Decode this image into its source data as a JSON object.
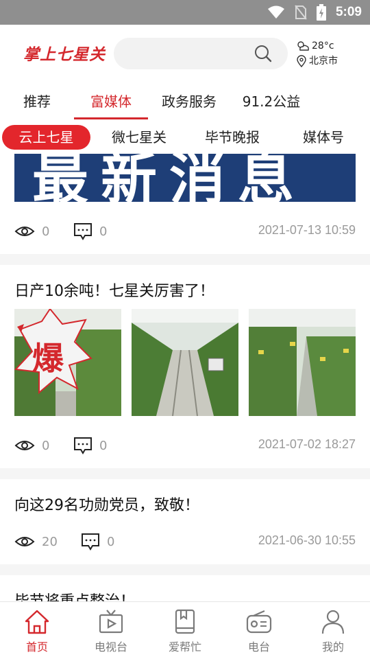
{
  "status_bar": {
    "time": "5:09",
    "icons": [
      "wifi-icon",
      "no-sim-icon",
      "battery-charging-icon"
    ]
  },
  "header": {
    "logo_text": "掌上七星关",
    "search": {
      "placeholder": "",
      "icon": "search-icon"
    },
    "weather": {
      "temperature": "28°c",
      "city": "北京市",
      "icons": [
        "partly-cloudy-icon",
        "location-pin-icon"
      ]
    }
  },
  "primary_tabs": [
    {
      "label": "推荐"
    },
    {
      "label": "富媒体",
      "active": true
    },
    {
      "label": "政务服务"
    },
    {
      "label": "91.2公益"
    }
  ],
  "secondary_tabs": [
    {
      "label": "云上七星",
      "active": true
    },
    {
      "label": "微七星关"
    },
    {
      "label": "毕节晚报"
    },
    {
      "label": "媒体号"
    }
  ],
  "feed": [
    {
      "banner_text": "最新消息",
      "views": "0",
      "comments": "0",
      "date": "2021-07-13 10:59"
    },
    {
      "title": "日产10余吨！七星关厉害了！",
      "badge_text": "爆",
      "views": "0",
      "comments": "0",
      "date": "2021-07-02 18:27"
    },
    {
      "title": "向这29名功勋党员，致敬！",
      "views": "20",
      "comments": "0",
      "date": "2021-06-30 10:55"
    },
    {
      "title": "毕节将重点整治！"
    }
  ],
  "bottom_nav": [
    {
      "label": "首页",
      "icon": "home-icon",
      "active": true
    },
    {
      "label": "电视台",
      "icon": "tv-icon"
    },
    {
      "label": "爱帮忙",
      "icon": "book-icon"
    },
    {
      "label": "电台",
      "icon": "radio-icon"
    },
    {
      "label": "我的",
      "icon": "user-icon"
    }
  ],
  "colors": {
    "accent": "#d4282d",
    "status_bar": "#8f8f8f",
    "banner": "#1e3e77"
  }
}
